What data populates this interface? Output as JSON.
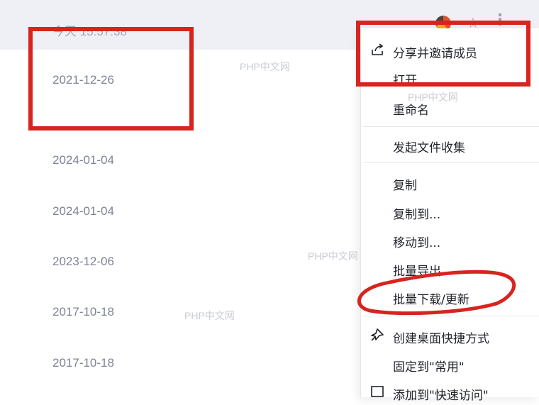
{
  "list": {
    "dates": [
      "今天 15:57:38",
      "2021-12-26",
      "2024-01-04",
      "2024-01-04",
      "2023-12-06",
      "2017-10-18",
      "2017-10-18"
    ]
  },
  "row_icons": [
    "avatar",
    "star-icon",
    "more-icon"
  ],
  "context_menu": {
    "items": [
      {
        "label": "分享并邀请成员",
        "icon": "share-icon"
      },
      {
        "label": "打开"
      },
      {
        "label": "重命名"
      },
      {
        "label": "发起文件收集"
      },
      {
        "label": "复制"
      },
      {
        "label": "复制到..."
      },
      {
        "label": "移动到..."
      },
      {
        "label": "批量导出"
      },
      {
        "label": "批量下载/更新"
      },
      {
        "label": "创建桌面快捷方式",
        "icon": "shortcut-pin-icon"
      },
      {
        "label": "固定到\"常用\""
      },
      {
        "label": "添加到\"快速访问\""
      }
    ]
  },
  "watermark": "PHP中文网",
  "annotation_color": "#d7241f",
  "colors": {
    "top_row_bg": "#eef0f5",
    "date_text": "#7d8494",
    "menu_text": "#1f2329"
  }
}
